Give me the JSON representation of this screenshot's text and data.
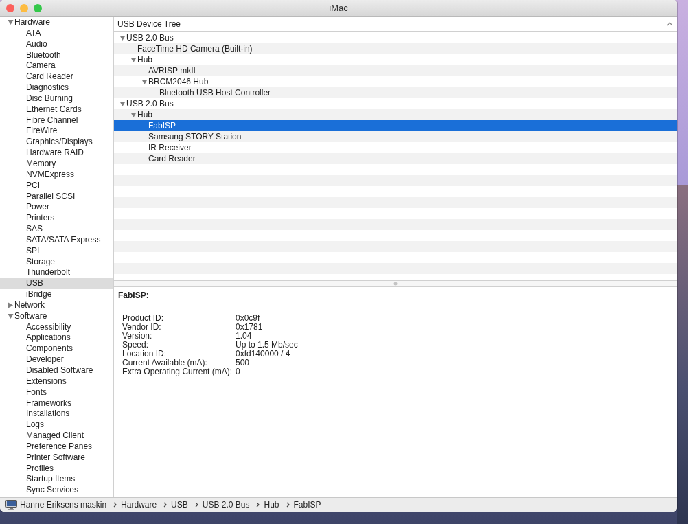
{
  "window": {
    "title": "iMac"
  },
  "sidebar": {
    "groups": [
      {
        "label": "Hardware",
        "expanded": true,
        "items": [
          {
            "label": "ATA",
            "selected": false
          },
          {
            "label": "Audio",
            "selected": false
          },
          {
            "label": "Bluetooth",
            "selected": false
          },
          {
            "label": "Camera",
            "selected": false
          },
          {
            "label": "Card Reader",
            "selected": false
          },
          {
            "label": "Diagnostics",
            "selected": false
          },
          {
            "label": "Disc Burning",
            "selected": false
          },
          {
            "label": "Ethernet Cards",
            "selected": false
          },
          {
            "label": "Fibre Channel",
            "selected": false
          },
          {
            "label": "FireWire",
            "selected": false
          },
          {
            "label": "Graphics/Displays",
            "selected": false
          },
          {
            "label": "Hardware RAID",
            "selected": false
          },
          {
            "label": "Memory",
            "selected": false
          },
          {
            "label": "NVMExpress",
            "selected": false
          },
          {
            "label": "PCI",
            "selected": false
          },
          {
            "label": "Parallel SCSI",
            "selected": false
          },
          {
            "label": "Power",
            "selected": false
          },
          {
            "label": "Printers",
            "selected": false
          },
          {
            "label": "SAS",
            "selected": false
          },
          {
            "label": "SATA/SATA Express",
            "selected": false
          },
          {
            "label": "SPI",
            "selected": false
          },
          {
            "label": "Storage",
            "selected": false
          },
          {
            "label": "Thunderbolt",
            "selected": false
          },
          {
            "label": "USB",
            "selected": true
          },
          {
            "label": "iBridge",
            "selected": false
          }
        ]
      },
      {
        "label": "Network",
        "expanded": false
      },
      {
        "label": "Software",
        "expanded": true,
        "items": [
          {
            "label": "Accessibility",
            "selected": false
          },
          {
            "label": "Applications",
            "selected": false
          },
          {
            "label": "Components",
            "selected": false
          },
          {
            "label": "Developer",
            "selected": false
          },
          {
            "label": "Disabled Software",
            "selected": false
          },
          {
            "label": "Extensions",
            "selected": false
          },
          {
            "label": "Fonts",
            "selected": false
          },
          {
            "label": "Frameworks",
            "selected": false
          },
          {
            "label": "Installations",
            "selected": false
          },
          {
            "label": "Logs",
            "selected": false
          },
          {
            "label": "Managed Client",
            "selected": false
          },
          {
            "label": "Preference Panes",
            "selected": false
          },
          {
            "label": "Printer Software",
            "selected": false
          },
          {
            "label": "Profiles",
            "selected": false
          },
          {
            "label": "Startup Items",
            "selected": false
          },
          {
            "label": "Sync Services",
            "selected": false
          }
        ]
      }
    ]
  },
  "tree": {
    "heading": "USB Device Tree",
    "items": [
      {
        "label": "USB 2.0 Bus",
        "expanded": true,
        "selected": false,
        "children": [
          {
            "label": "FaceTime HD Camera (Built-in)",
            "selected": false
          },
          {
            "label": "Hub",
            "expanded": true,
            "selected": false,
            "children": [
              {
                "label": "AVRISP mkII",
                "selected": false
              },
              {
                "label": "BRCM2046 Hub",
                "expanded": true,
                "selected": false,
                "children": [
                  {
                    "label": "Bluetooth USB Host Controller",
                    "selected": false
                  }
                ]
              }
            ]
          }
        ]
      },
      {
        "label": "USB 2.0 Bus",
        "expanded": true,
        "selected": false,
        "children": [
          {
            "label": "Hub",
            "expanded": true,
            "selected": false,
            "children": [
              {
                "label": "FabISP",
                "selected": true
              },
              {
                "label": "Samsung STORY Station",
                "selected": false
              },
              {
                "label": "IR Receiver",
                "selected": false
              },
              {
                "label": "Card Reader",
                "selected": false
              }
            ]
          }
        ]
      }
    ]
  },
  "details": {
    "title": "FabISP:",
    "fields": [
      {
        "label": "Product ID:",
        "value": "0x0c9f"
      },
      {
        "label": "Vendor ID:",
        "value": "0x1781"
      },
      {
        "label": "Version:",
        "value": "1.04"
      },
      {
        "label": "Speed:",
        "value": "Up to 1.5 Mb/sec"
      },
      {
        "label": "Location ID:",
        "value": "0xfd140000 / 4"
      },
      {
        "label": "Current Available (mA):",
        "value": "500"
      },
      {
        "label": "Extra Operating Current (mA):",
        "value": "0"
      }
    ]
  },
  "path_bar": [
    "Hanne Eriksens maskin",
    "Hardware",
    "USB",
    "USB 2.0 Bus",
    "Hub",
    "FabISP"
  ]
}
